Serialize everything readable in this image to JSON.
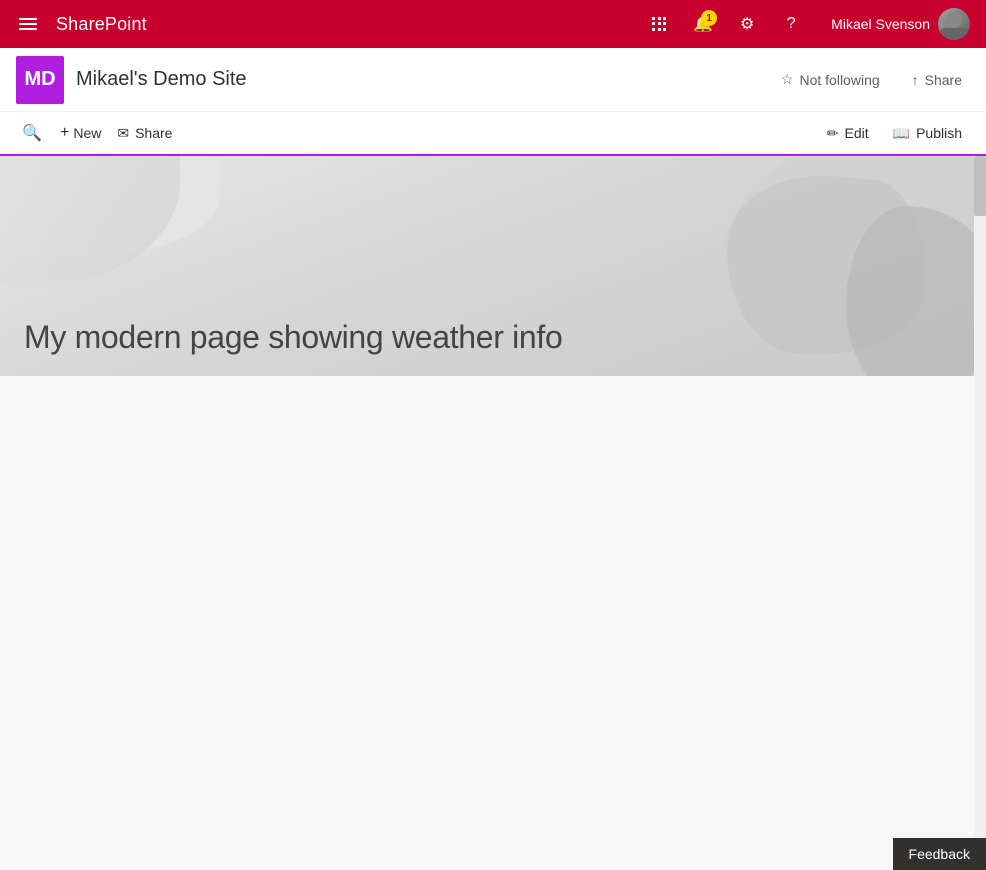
{
  "topnav": {
    "brand": "SharePoint",
    "hamburger_label": "Open menu",
    "apps_icon": "⊞",
    "notification_icon": "🔔",
    "notification_count": "1",
    "settings_icon": "⚙",
    "help_icon": "?",
    "user_name": "Mikael Svenson"
  },
  "site_header": {
    "logo_initials": "MD",
    "site_title": "Mikael's Demo Site",
    "not_following_label": "Not following",
    "share_label": "Share"
  },
  "command_bar": {
    "new_label": "New",
    "share_label": "Share",
    "edit_label": "Edit",
    "publish_label": "Publish"
  },
  "hero": {
    "title": "My modern page showing weather info"
  },
  "feedback": {
    "label": "Feedback"
  }
}
